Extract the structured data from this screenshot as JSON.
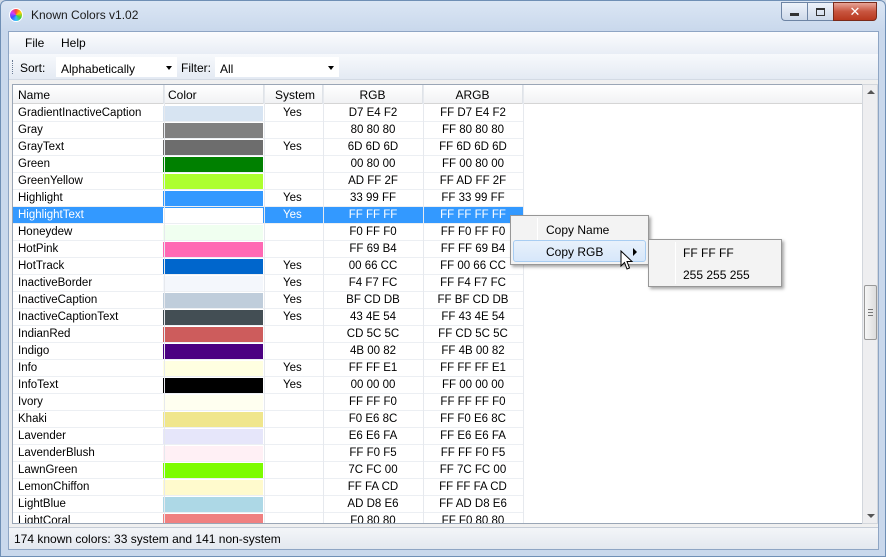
{
  "window": {
    "title": "Known Colors v1.02"
  },
  "menu": {
    "file": "File",
    "help": "Help"
  },
  "toolbar": {
    "sort_label": "Sort:",
    "sort_value": "Alphabetically",
    "filter_label": "Filter:",
    "filter_value": "All"
  },
  "table": {
    "headers": [
      "Name",
      "Color",
      "System",
      "RGB",
      "ARGB"
    ],
    "rows": [
      {
        "name": "GradientInactiveCaption",
        "color": "#D7E4F2",
        "system": "Yes",
        "rgb": "D7 E4 F2",
        "argb": "FF D7 E4 F2"
      },
      {
        "name": "Gray",
        "color": "#808080",
        "system": "",
        "rgb": "80 80 80",
        "argb": "FF 80 80 80"
      },
      {
        "name": "GrayText",
        "color": "#6D6D6D",
        "system": "Yes",
        "rgb": "6D 6D 6D",
        "argb": "FF 6D 6D 6D"
      },
      {
        "name": "Green",
        "color": "#008000",
        "system": "",
        "rgb": "00 80 00",
        "argb": "FF 00 80 00"
      },
      {
        "name": "GreenYellow",
        "color": "#ADFF2F",
        "system": "",
        "rgb": "AD FF 2F",
        "argb": "FF AD FF 2F"
      },
      {
        "name": "Highlight",
        "color": "#3399FF",
        "system": "Yes",
        "rgb": "33 99 FF",
        "argb": "FF 33 99 FF"
      },
      {
        "name": "HighlightText",
        "color": "#FFFFFF",
        "system": "Yes",
        "rgb": "FF FF FF",
        "argb": "FF FF FF FF",
        "selected": true
      },
      {
        "name": "Honeydew",
        "color": "#F0FFF0",
        "system": "",
        "rgb": "F0 FF F0",
        "argb": "FF F0 FF F0"
      },
      {
        "name": "HotPink",
        "color": "#FF69B4",
        "system": "",
        "rgb": "FF 69 B4",
        "argb": "FF FF 69 B4"
      },
      {
        "name": "HotTrack",
        "color": "#0066CC",
        "system": "Yes",
        "rgb": "00 66 CC",
        "argb": "FF 00 66 CC"
      },
      {
        "name": "InactiveBorder",
        "color": "#F4F7FC",
        "system": "Yes",
        "rgb": "F4 F7 FC",
        "argb": "FF F4 F7 FC"
      },
      {
        "name": "InactiveCaption",
        "color": "#BFCDDB",
        "system": "Yes",
        "rgb": "BF CD DB",
        "argb": "FF BF CD DB"
      },
      {
        "name": "InactiveCaptionText",
        "color": "#434E54",
        "system": "Yes",
        "rgb": "43 4E 54",
        "argb": "FF 43 4E 54"
      },
      {
        "name": "IndianRed",
        "color": "#CD5C5C",
        "system": "",
        "rgb": "CD 5C 5C",
        "argb": "FF CD 5C 5C"
      },
      {
        "name": "Indigo",
        "color": "#4B0082",
        "system": "",
        "rgb": "4B 00 82",
        "argb": "FF 4B 00 82"
      },
      {
        "name": "Info",
        "color": "#FFFFE1",
        "system": "Yes",
        "rgb": "FF FF E1",
        "argb": "FF FF FF E1"
      },
      {
        "name": "InfoText",
        "color": "#000000",
        "system": "Yes",
        "rgb": "00 00 00",
        "argb": "FF 00 00 00"
      },
      {
        "name": "Ivory",
        "color": "#FFFFF0",
        "system": "",
        "rgb": "FF FF F0",
        "argb": "FF FF FF F0"
      },
      {
        "name": "Khaki",
        "color": "#F0E68C",
        "system": "",
        "rgb": "F0 E6 8C",
        "argb": "FF F0 E6 8C"
      },
      {
        "name": "Lavender",
        "color": "#E6E6FA",
        "system": "",
        "rgb": "E6 E6 FA",
        "argb": "FF E6 E6 FA"
      },
      {
        "name": "LavenderBlush",
        "color": "#FFF0F5",
        "system": "",
        "rgb": "FF F0 F5",
        "argb": "FF FF F0 F5"
      },
      {
        "name": "LawnGreen",
        "color": "#7CFC00",
        "system": "",
        "rgb": "7C FC 00",
        "argb": "FF 7C FC 00"
      },
      {
        "name": "LemonChiffon",
        "color": "#FFFACD",
        "system": "",
        "rgb": "FF FA CD",
        "argb": "FF FF FA CD"
      },
      {
        "name": "LightBlue",
        "color": "#ADD8E6",
        "system": "",
        "rgb": "AD D8 E6",
        "argb": "FF AD D8 E6"
      },
      {
        "name": "LightCoral",
        "color": "#F08080",
        "system": "",
        "rgb": "F0 80 80",
        "argb": "FF F0 80 80"
      }
    ]
  },
  "context_menu": {
    "items": [
      {
        "label": "Copy Name"
      },
      {
        "label": "Copy RGB",
        "has_submenu": true
      }
    ],
    "submenu": [
      "FF FF FF",
      "255 255 255"
    ]
  },
  "statusbar": {
    "text": "174 known colors: 33 system and 141 non-system"
  },
  "icons": {
    "app": "color-wheel-icon",
    "minimize": "minimize-icon",
    "maximize": "maximize-icon",
    "close": "close-icon",
    "dropdown": "chevron-down-icon",
    "submenu": "chevron-right-icon",
    "cursor": "mouse-pointer-icon"
  }
}
